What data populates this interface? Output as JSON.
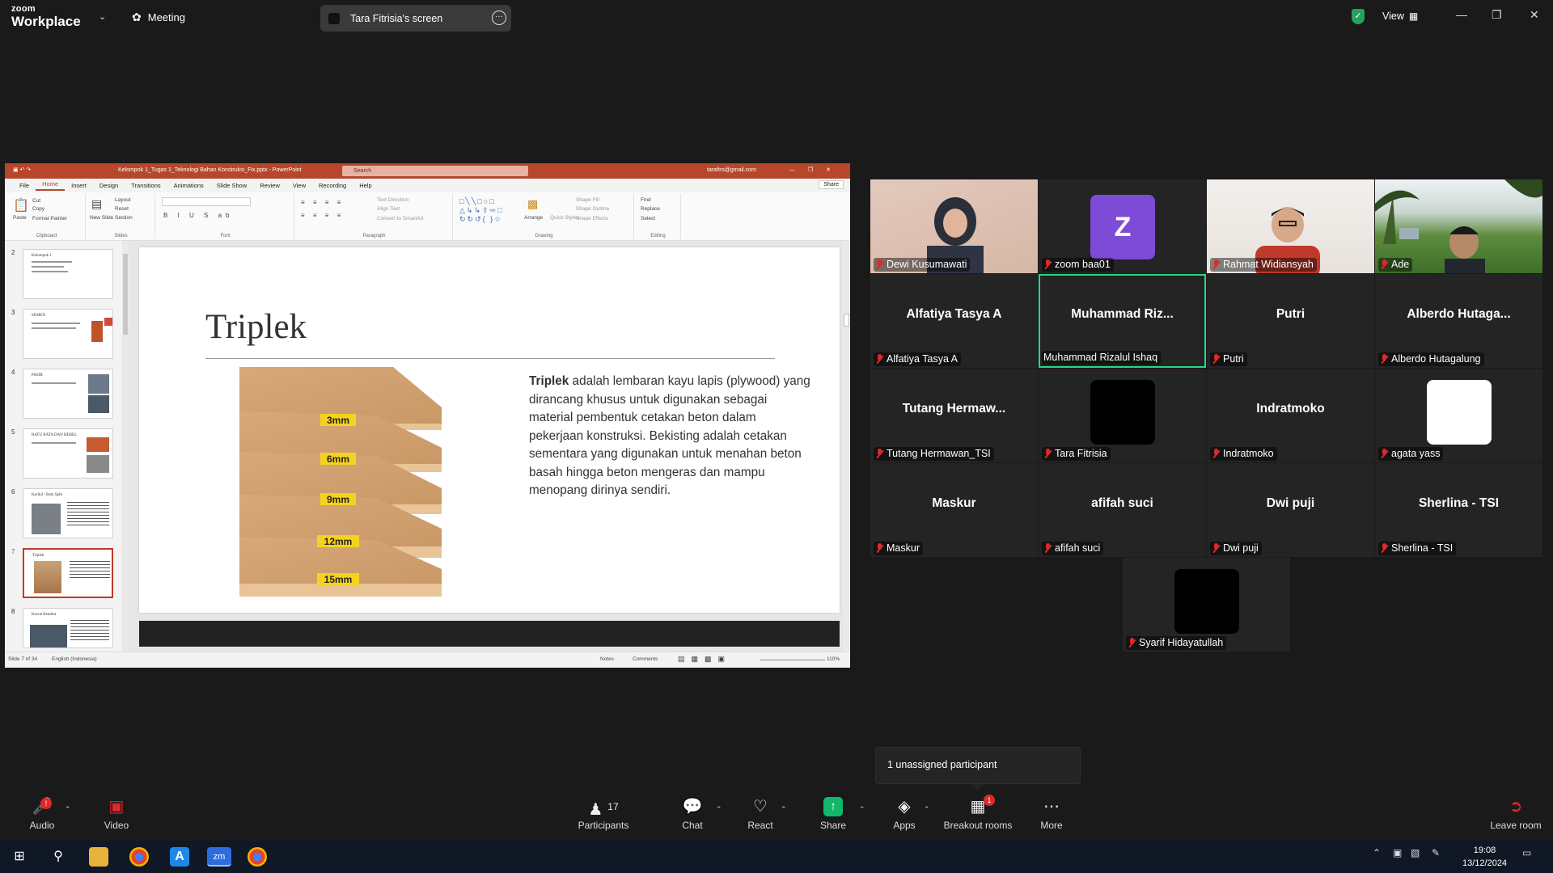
{
  "topbar": {
    "logo_line1": "zoom",
    "logo_line2": "Workplace",
    "meeting_label": "Meeting",
    "screen_share_label": "Tara Fitrisia's screen",
    "view_label": "View"
  },
  "ppt": {
    "doc_title": "Kelompok 1_Tugas 1_Teknologi Bahan Konstruksi_Fix.pptx - PowerPoint",
    "search_placeholder": "Search",
    "account": "taraftrs@gmail.com",
    "tabs": [
      "File",
      "Home",
      "Insert",
      "Design",
      "Transitions",
      "Animations",
      "Slide Show",
      "Review",
      "View",
      "Recording",
      "Help"
    ],
    "share_label": "Share",
    "ribbon": {
      "clipboard": "Clipboard",
      "paste": "Paste",
      "cut": "Cut",
      "copy": "Copy",
      "format_painter": "Format Painter",
      "slides": "Slides",
      "new_slide": "New Slide",
      "layout": "Layout",
      "reset": "Reset",
      "section": "Section",
      "font": "Font",
      "paragraph": "Paragraph",
      "text_direction": "Text Direction",
      "align_text": "Align Text",
      "convert_smartart": "Convert to SmartArt",
      "drawing": "Drawing",
      "arrange": "Arrange",
      "quick_styles": "Quick Styles",
      "shape_fill": "Shape Fill",
      "shape_outline": "Shape Outline",
      "shape_effects": "Shape Effects",
      "editing": "Editing",
      "find": "Find",
      "replace": "Replace",
      "select": "Select"
    },
    "thumbnails": [
      {
        "num": "2",
        "title": "Kelompok 1"
      },
      {
        "num": "3",
        "title": "SEMEN"
      },
      {
        "num": "4",
        "title": "PASIR"
      },
      {
        "num": "5",
        "title": "BATU BATA DAN HEBEL"
      },
      {
        "num": "6",
        "title": "Kerikil / Batu Split"
      },
      {
        "num": "7",
        "title": "Triplek"
      },
      {
        "num": "8",
        "title": "Kawat Bendrat"
      }
    ],
    "slide": {
      "title": "Triplek",
      "body_bold": "Triplek",
      "body": " adalah lembaran kayu lapis (plywood) yang dirancang khusus untuk digunakan sebagai material pembentuk cetakan beton dalam pekerjaan konstruksi. Bekisting adalah cetakan sementara yang digunakan untuk menahan beton basah hingga beton mengeras dan mampu menopang dirinya sendiri.",
      "ply_labels": [
        "3mm",
        "6mm",
        "9mm",
        "12mm",
        "15mm"
      ]
    },
    "status_left": "Slide 7 of 34",
    "status_lang": "English (Indonesia)",
    "status_notes": "Notes",
    "status_comments": "Comments",
    "status_zoom": "110%"
  },
  "participants_gallery": [
    {
      "tile_name": "",
      "label": "Dewi Kusumawati",
      "muted": true,
      "kind": "video"
    },
    {
      "tile_name": "",
      "label": "zoom baa01",
      "muted": true,
      "kind": "avatar",
      "avatar": "Z"
    },
    {
      "tile_name": "",
      "label": "Rahmat Widiansyah",
      "muted": true,
      "kind": "video"
    },
    {
      "tile_name": "",
      "label": "Ade",
      "muted": true,
      "kind": "video"
    },
    {
      "tile_name": "Alfatiya Tasya A",
      "label": "Alfatiya Tasya A",
      "muted": true
    },
    {
      "tile_name": "Muhammad  Riz...",
      "label": "Muhammad Rizalul Ishaq",
      "muted": false,
      "speaking": true
    },
    {
      "tile_name": "Putri",
      "label": "Putri",
      "muted": true
    },
    {
      "tile_name": "Alberdo  Hutaga...",
      "label": "Alberdo Hutagalung",
      "muted": true
    },
    {
      "tile_name": "Tutang  Hermaw...",
      "label": "Tutang Hermawan_TSI",
      "muted": true
    },
    {
      "tile_name": "",
      "label": "Tara Fitrisia",
      "muted": true,
      "kind": "black"
    },
    {
      "tile_name": "Indratmoko",
      "label": "Indratmoko",
      "muted": true
    },
    {
      "tile_name": "",
      "label": "agata yass",
      "muted": true,
      "kind": "white"
    },
    {
      "tile_name": "Maskur",
      "label": "Maskur",
      "muted": true
    },
    {
      "tile_name": "afifah suci",
      "label": "afifah suci",
      "muted": true
    },
    {
      "tile_name": "Dwi puji",
      "label": "Dwi puji",
      "muted": true
    },
    {
      "tile_name": "Sherlina - TSI",
      "label": "Sherlina - TSI",
      "muted": true
    },
    {
      "tile_name": "",
      "label": "Syarif Hidayatullah",
      "muted": true,
      "kind": "black"
    }
  ],
  "toast": "1 unassigned participant",
  "toolbar": {
    "audio": "Audio",
    "video": "Video",
    "participants": "Participants",
    "participants_count": "17",
    "chat": "Chat",
    "react": "React",
    "share": "Share",
    "apps": "Apps",
    "breakout": "Breakout rooms",
    "breakout_badge": "1",
    "more": "More",
    "leave": "Leave room"
  },
  "taskbar": {
    "time": "19:08",
    "date": "13/12/2024"
  },
  "colors": {
    "ppt_accent": "#b7472a",
    "speaking_border": "#23d98a",
    "muted_red": "#e02828",
    "share_green": "#12b76a",
    "avatar_purple": "#7e4bd6"
  }
}
